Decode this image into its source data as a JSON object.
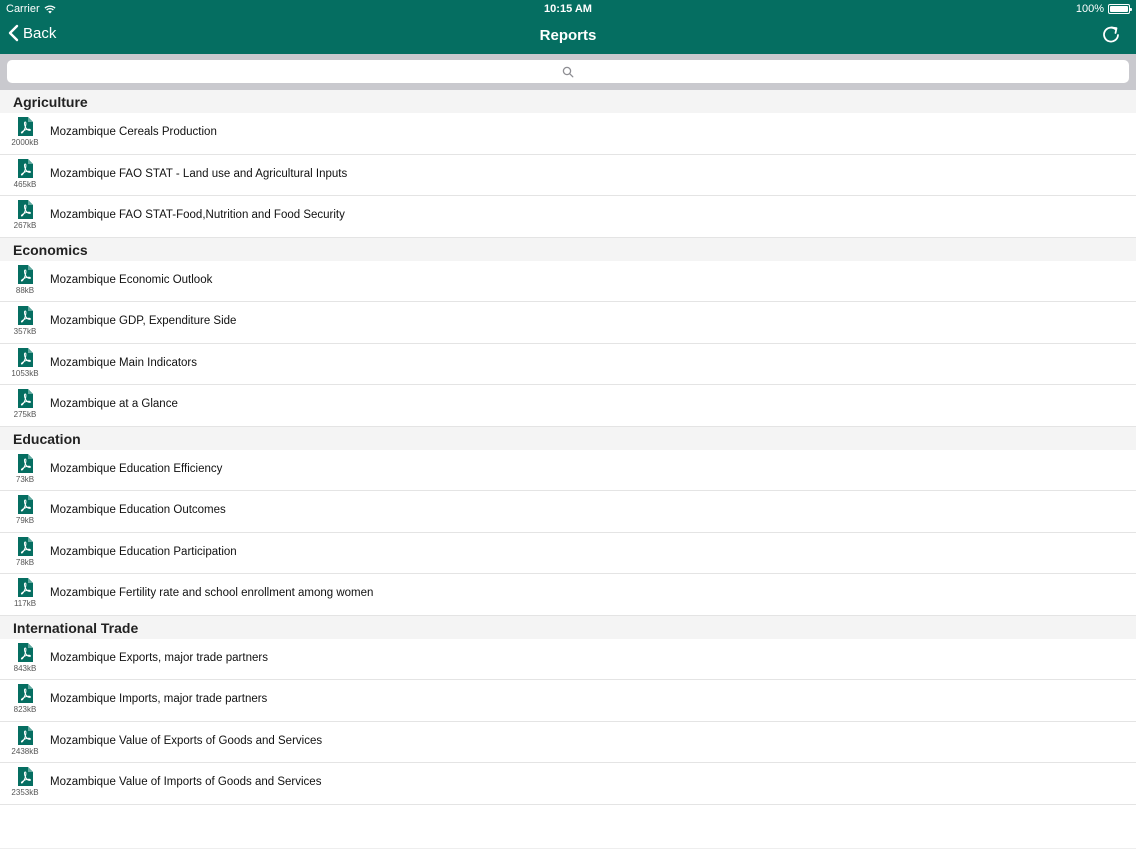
{
  "status_bar": {
    "carrier": "Carrier",
    "time": "10:15 AM",
    "battery": "100%"
  },
  "nav": {
    "back_label": "Back",
    "title": "Reports"
  },
  "search": {
    "placeholder": ""
  },
  "colors": {
    "accent": "#056e61",
    "section_bg": "#f4f4f4",
    "search_bg": "#c9c9ce"
  },
  "sections": [
    {
      "title": "Agriculture",
      "items": [
        {
          "label": "Mozambique Cereals Production",
          "size": "2000kB"
        },
        {
          "label": "Mozambique FAO STAT - Land use and Agricultural Inputs",
          "size": "465kB"
        },
        {
          "label": "Mozambique FAO STAT-Food,Nutrition and Food Security",
          "size": "267kB"
        }
      ]
    },
    {
      "title": "Economics",
      "items": [
        {
          "label": "Mozambique Economic Outlook",
          "size": "88kB"
        },
        {
          "label": "Mozambique GDP, Expenditure Side",
          "size": "357kB"
        },
        {
          "label": "Mozambique Main Indicators",
          "size": "1053kB"
        },
        {
          "label": "Mozambique at a Glance",
          "size": "275kB"
        }
      ]
    },
    {
      "title": "Education",
      "items": [
        {
          "label": "Mozambique Education Efficiency",
          "size": "73kB"
        },
        {
          "label": "Mozambique Education Outcomes",
          "size": "79kB"
        },
        {
          "label": "Mozambique Education Participation",
          "size": "78kB"
        },
        {
          "label": "Mozambique Fertility rate and school enrollment among women",
          "size": "117kB"
        }
      ]
    },
    {
      "title": "International Trade",
      "items": [
        {
          "label": "Mozambique Exports, major trade partners",
          "size": "843kB"
        },
        {
          "label": "Mozambique Imports, major trade partners",
          "size": "823kB"
        },
        {
          "label": "Mozambique Value of Exports of Goods and Services",
          "size": "2438kB"
        },
        {
          "label": "Mozambique Value of Imports of Goods and Services",
          "size": "2353kB"
        }
      ]
    }
  ]
}
